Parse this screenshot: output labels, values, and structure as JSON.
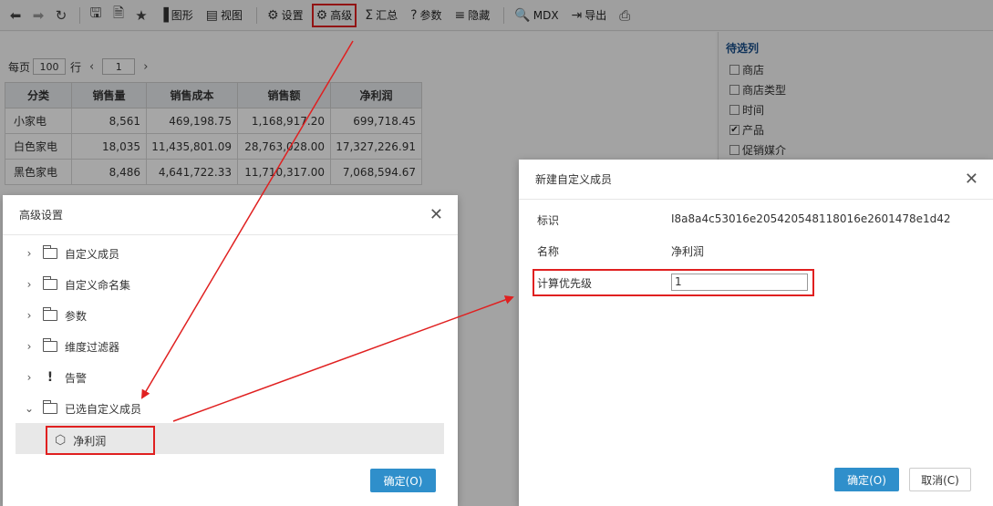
{
  "toolbar": {
    "icons": [
      "back-icon",
      "forward-icon",
      "refresh-icon",
      "save-icon",
      "save-as-icon",
      "favorite-icon"
    ],
    "buttons": [
      {
        "label": "图形",
        "icon": "bar-chart-icon"
      },
      {
        "label": "视图",
        "icon": "view-icon"
      },
      {
        "label": "设置",
        "icon": "gear-icon"
      },
      {
        "label": "高级",
        "icon": "advanced-icon"
      },
      {
        "label": "汇总",
        "icon": "sigma-icon"
      },
      {
        "label": "参数",
        "icon": "question-icon"
      },
      {
        "label": "隐藏",
        "icon": "hide-icon"
      },
      {
        "label": "MDX",
        "icon": "search-icon"
      },
      {
        "label": "导出",
        "icon": "export-icon"
      }
    ],
    "print_icon": "print-icon"
  },
  "pager": {
    "per_page_label": "每页",
    "per_page_value": "100",
    "rows_label": "行",
    "page_value": "1"
  },
  "table": {
    "headers": [
      "分类",
      "销售量",
      "销售成本",
      "销售额",
      "净利润"
    ],
    "rows": [
      [
        "小家电",
        "8,561",
        "469,198.75",
        "1,168,917.20",
        "699,718.45"
      ],
      [
        "白色家电",
        "18,035",
        "11,435,801.09",
        "28,763,028.00",
        "17,327,226.91"
      ],
      [
        "黑色家电",
        "8,486",
        "4,641,722.33",
        "11,710,317.00",
        "7,068,594.67"
      ]
    ]
  },
  "side": {
    "title": "待选列",
    "items": [
      {
        "label": "商店",
        "checked": false
      },
      {
        "label": "商店类型",
        "checked": false
      },
      {
        "label": "时间",
        "checked": false
      },
      {
        "label": "产品",
        "checked": true
      },
      {
        "label": "促销媒介",
        "checked": false
      }
    ]
  },
  "advanced_dialog": {
    "title": "高级设置",
    "tree": [
      "自定义成员",
      "自定义命名集",
      "参数",
      "维度过滤器",
      "告警",
      "已选自定义成员"
    ],
    "selected_child": "净利润",
    "ok_label": "确定(O)"
  },
  "new_member_dialog": {
    "title": "新建自定义成员",
    "id_label": "标识",
    "id_value": "I8a8a4c53016e205420548118016e2601478e1d42",
    "name_label": "名称",
    "name_value": "净利润",
    "priority_label": "计算优先级",
    "priority_value": "1",
    "ok_label": "确定(O)",
    "cancel_label": "取消(C)"
  },
  "colors": {
    "highlight": "#e02020",
    "primary_button": "#2f8fcb"
  }
}
